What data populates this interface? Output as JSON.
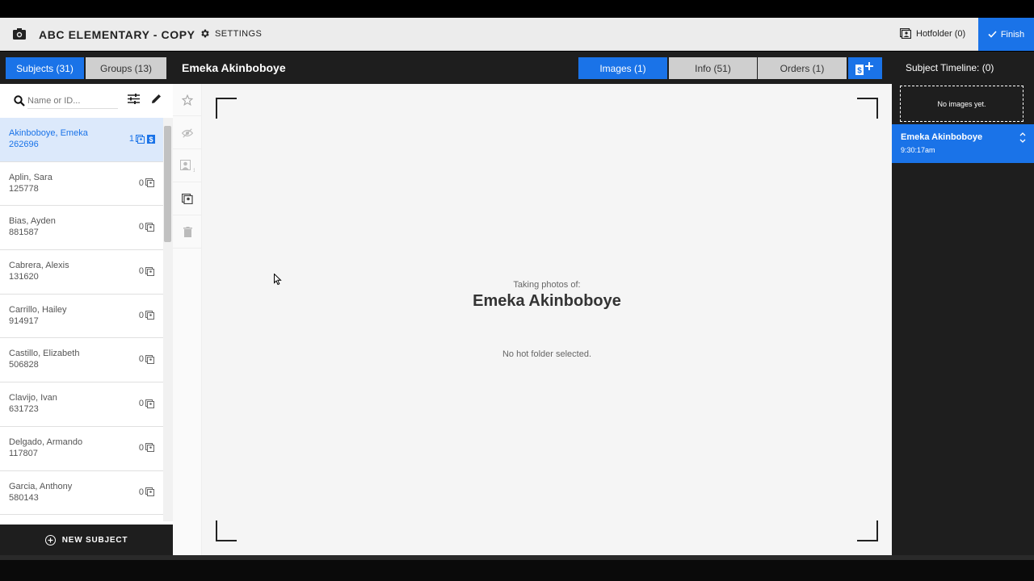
{
  "app": {
    "title": "ABC ELEMENTARY - COPY",
    "settings_label": "SETTINGS",
    "hotfolder_label": "Hotfolder (0)",
    "finish_label": "Finish"
  },
  "subbar": {
    "subjects_tab": "Subjects (31)",
    "groups_tab": "Groups (13)",
    "current_subject": "Emeka Akinboboye",
    "images_tab": "Images (1)",
    "info_tab": "Info (51)",
    "orders_tab": "Orders (1)"
  },
  "search": {
    "placeholder": "Name or ID..."
  },
  "subjects": [
    {
      "name": "Akinboboye, Emeka",
      "id": "262696",
      "count": "1",
      "selected": true
    },
    {
      "name": "Aplin, Sara",
      "id": "125778",
      "count": "0",
      "selected": false
    },
    {
      "name": "Bias, Ayden",
      "id": "881587",
      "count": "0",
      "selected": false
    },
    {
      "name": "Cabrera, Alexis",
      "id": "131620",
      "count": "0",
      "selected": false
    },
    {
      "name": "Carrillo, Hailey",
      "id": "914917",
      "count": "0",
      "selected": false
    },
    {
      "name": "Castillo, Elizabeth",
      "id": "506828",
      "count": "0",
      "selected": false
    },
    {
      "name": "Clavijo, Ivan",
      "id": "631723",
      "count": "0",
      "selected": false
    },
    {
      "name": "Delgado, Armando",
      "id": "117807",
      "count": "0",
      "selected": false
    },
    {
      "name": "Garcia, Anthony",
      "id": "580143",
      "count": "0",
      "selected": false
    }
  ],
  "new_subject_label": "NEW SUBJECT",
  "center": {
    "taking_label": "Taking photos of:",
    "subject_name": "Emeka Akinboboye",
    "hotfolder_status": "No hot folder selected."
  },
  "timeline": {
    "title": "Subject Timeline: (0)",
    "no_images": "No images yet.",
    "entry_name": "Emeka Akinboboye",
    "entry_time": "9:30:17am"
  },
  "colors": {
    "accent": "#1a73e8",
    "dark": "#1e1e1e",
    "topbar": "#ececec"
  },
  "icons": {
    "app": "camera-icon",
    "settings": "gear-icon",
    "hotfolder": "folder-image-icon",
    "finish": "check-icon",
    "search": "search-icon",
    "filter": "sliders-icon",
    "edit": "pencil-icon",
    "add_order": "dollar-plus-icon"
  }
}
